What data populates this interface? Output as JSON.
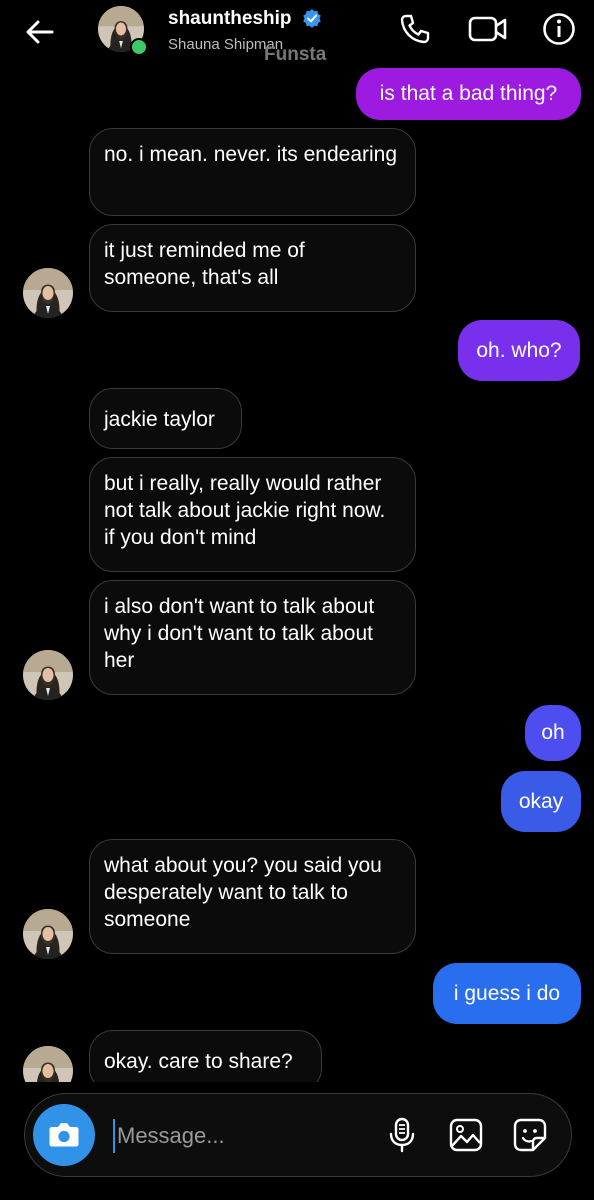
{
  "header": {
    "username": "shauntheship",
    "display_name": "Shauna Shipman",
    "watermark": "Funsta",
    "back_icon": "back-arrow-icon",
    "call_icon": "phone-icon",
    "video_icon": "video-camera-icon",
    "info_icon": "info-icon",
    "verified_icon": "verified-badge-icon",
    "online_color": "#3ec86a"
  },
  "messages": [
    {
      "side": "out",
      "text": "is that a bad thing?"
    },
    {
      "side": "in",
      "text": "no. i mean. never. its endearing"
    },
    {
      "side": "in",
      "text": "it just reminded me of someone, that's all"
    },
    {
      "side": "out",
      "text": "oh. who?"
    },
    {
      "side": "in",
      "text": "jackie taylor"
    },
    {
      "side": "in",
      "text": "but i really, really would rather not talk about jackie right now. if you don't mind"
    },
    {
      "side": "in",
      "text": "i also don't want to talk about why i don't want to talk about her"
    },
    {
      "side": "out",
      "text": "oh"
    },
    {
      "side": "out",
      "text": "okay"
    },
    {
      "side": "in",
      "text": "what about you? you said you desperately want to talk to someone"
    },
    {
      "side": "out",
      "text": "i guess i do"
    },
    {
      "side": "in",
      "text": "okay. care to share?"
    }
  ],
  "composer": {
    "placeholder": "Message...",
    "camera_icon": "camera-icon",
    "mic_icon": "microphone-icon",
    "gallery_icon": "gallery-icon",
    "sticker_icon": "sticker-icon"
  },
  "colors": {
    "background": "#000000",
    "incoming_bubble": "#0b0b0b",
    "outgoing_gradient": [
      "#9d1be0",
      "#7830ec",
      "#4d4df0",
      "#3a5be8",
      "#2a6ef0"
    ],
    "accent": "#3093e8"
  }
}
